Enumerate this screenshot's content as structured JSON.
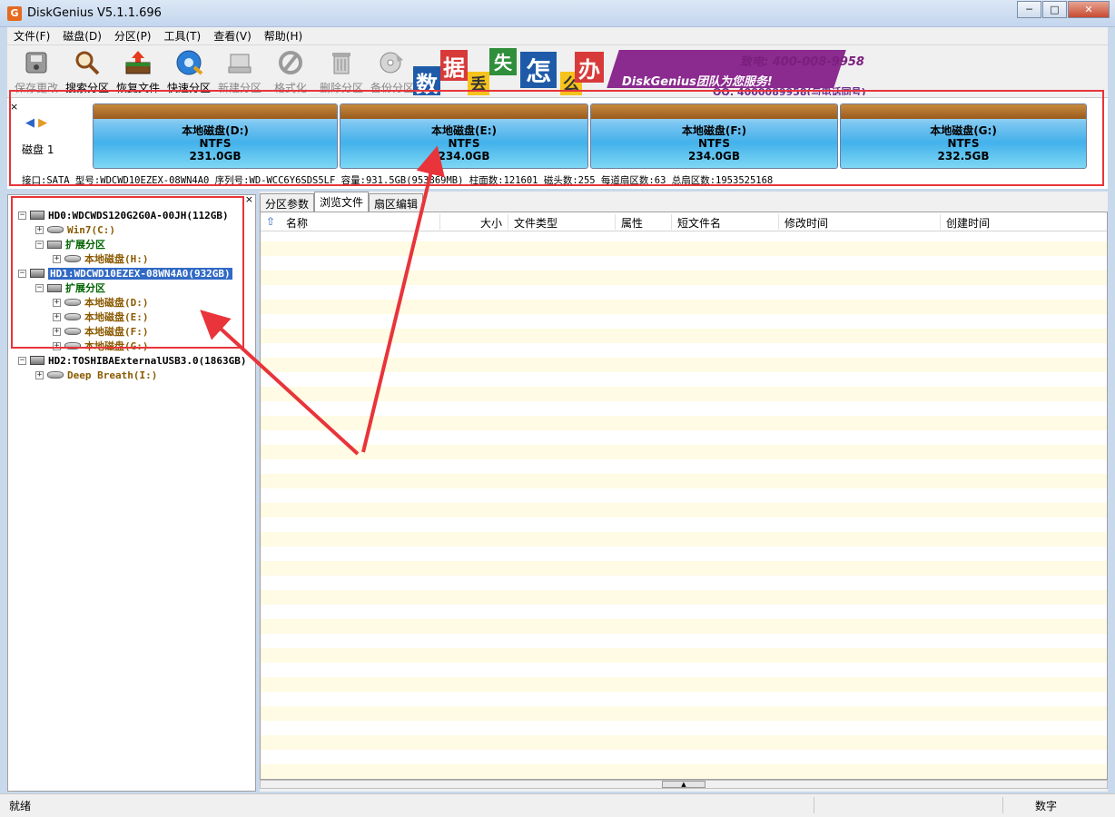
{
  "window": {
    "title": "DiskGenius V5.1.1.696",
    "icon_letter": "G",
    "buttons": [
      "─",
      "□",
      "✕"
    ]
  },
  "menu": [
    "文件(F)",
    "磁盘(D)",
    "分区(P)",
    "工具(T)",
    "查看(V)",
    "帮助(H)"
  ],
  "toolbar": [
    {
      "label": "保存更改",
      "icon": "save-disk-icon",
      "enabled": false
    },
    {
      "label": "搜索分区",
      "icon": "magnifier-icon",
      "enabled": true
    },
    {
      "label": "恢复文件",
      "icon": "recover-box-icon",
      "enabled": true
    },
    {
      "label": "快速分区",
      "icon": "quick-partition-icon",
      "enabled": true
    },
    {
      "label": "新建分区",
      "icon": "new-partition-icon",
      "enabled": false
    },
    {
      "label": "格式化",
      "icon": "format-icon",
      "enabled": false
    },
    {
      "label": "删除分区",
      "icon": "trash-icon",
      "enabled": false
    },
    {
      "label": "备份分区",
      "icon": "backup-disc-icon",
      "enabled": false
    }
  ],
  "banner": {
    "chars": [
      "数",
      "据",
      "丢",
      "失",
      "怎",
      "么",
      "办"
    ],
    "slogan": "DiskGenius团队为您服务!",
    "phone": "400-008-9958",
    "phone_prefix": "致电:",
    "qq": "QQ: 4000089958(与电话同号)",
    "colors": [
      "#1e5aa8",
      "#d83a3a",
      "#f5c31c",
      "#2f8f3a",
      "#1e5aa8",
      "#f5c31c",
      "#d83a3a"
    ]
  },
  "disk_map": {
    "disk_label": "磁盘 1",
    "partitions": [
      {
        "name": "本地磁盘(D:)",
        "fs": "NTFS",
        "size": "231.0GB"
      },
      {
        "name": "本地磁盘(E:)",
        "fs": "NTFS",
        "size": "234.0GB"
      },
      {
        "name": "本地磁盘(F:)",
        "fs": "NTFS",
        "size": "234.0GB"
      },
      {
        "name": "本地磁盘(G:)",
        "fs": "NTFS",
        "size": "232.5GB"
      }
    ],
    "info": "接口:SATA  型号:WDCWD10EZEX-08WN4A0  序列号:WD-WCC6Y6SDS5LF  容量:931.5GB(953869MB)  柱面数:121601  磁头数:255  每道扇区数:63  总扇区数:1953525168"
  },
  "tree": [
    {
      "label": "HD0:WDCWDS120G2G0A-00JH(112GB)",
      "type": "disk",
      "expander": "−",
      "color": "black"
    },
    {
      "label": "Win7(C:)",
      "type": "volume",
      "expander": "+",
      "color": "brown"
    },
    {
      "label": "扩展分区",
      "type": "extended",
      "expander": "−",
      "color": "green"
    },
    {
      "label": "本地磁盘(H:)",
      "type": "volume",
      "expander": "+",
      "color": "brown"
    },
    {
      "label": "HD1:WDCWD10EZEX-08WN4A0(932GB)",
      "type": "disk",
      "expander": "−",
      "color": "black",
      "selected": true
    },
    {
      "label": "扩展分区",
      "type": "extended",
      "expander": "−",
      "color": "green"
    },
    {
      "label": "本地磁盘(D:)",
      "type": "volume",
      "expander": "+",
      "color": "brown"
    },
    {
      "label": "本地磁盘(E:)",
      "type": "volume",
      "expander": "+",
      "color": "brown"
    },
    {
      "label": "本地磁盘(F:)",
      "type": "volume",
      "expander": "+",
      "color": "brown"
    },
    {
      "label": "本地磁盘(G:)",
      "type": "volume",
      "expander": "+",
      "color": "brown"
    },
    {
      "label": "HD2:TOSHIBAExternalUSB3.0(1863GB)",
      "type": "disk",
      "expander": "−",
      "color": "black"
    },
    {
      "label": "Deep Breath(I:)",
      "type": "volume",
      "expander": "+",
      "color": "brown"
    }
  ],
  "tabs": [
    {
      "label": "分区参数",
      "active": false
    },
    {
      "label": "浏览文件",
      "active": true
    },
    {
      "label": "扇区编辑",
      "active": false
    }
  ],
  "file_columns": [
    "名称",
    "大小",
    "文件类型",
    "属性",
    "短文件名",
    "修改时间",
    "创建时间"
  ],
  "status": {
    "text": "就绪",
    "num": "数字"
  },
  "close_glyph": "×",
  "nav": {
    "left": "◀",
    "right": "▶"
  }
}
